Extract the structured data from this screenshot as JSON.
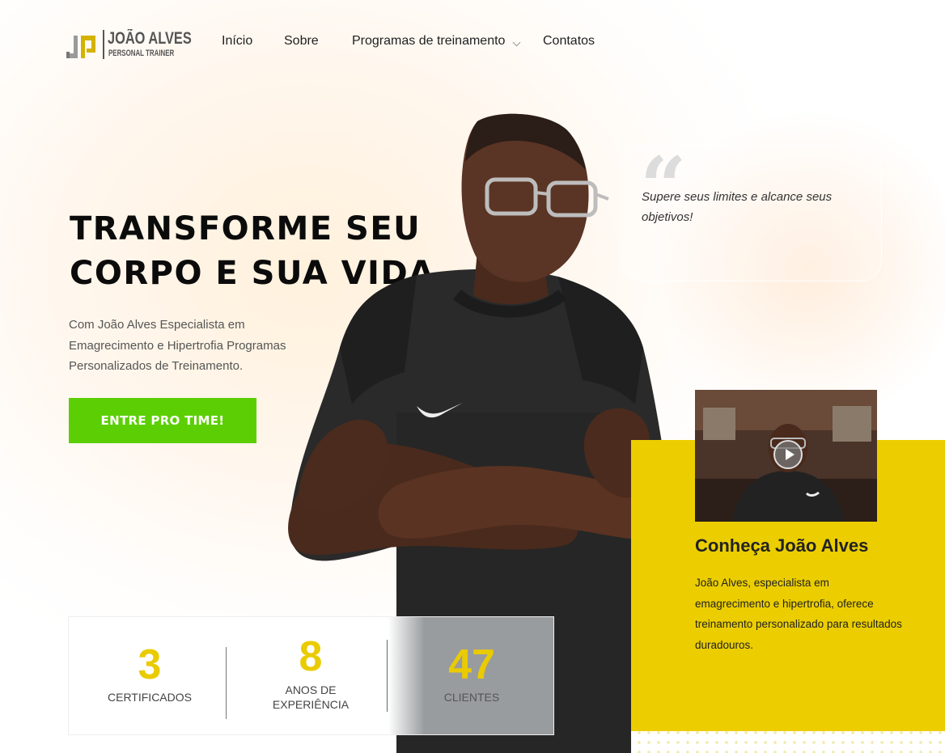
{
  "brand": {
    "name": "JOÃO ALVES",
    "subtitle": "PERSONAL TRAINER",
    "icon": "jp-monogram-logo"
  },
  "nav": {
    "items": [
      {
        "label": "Início"
      },
      {
        "label": "Sobre"
      },
      {
        "label": "Programas de treinamento",
        "has_dropdown": true
      },
      {
        "label": "Contatos"
      }
    ]
  },
  "hero": {
    "title_line1": "TRANSFORME SEU",
    "title_line2": "CORPO E SUA VIDA",
    "description": "Com João Alves Especialista em Emagrecimento e Hipertrofia Programas Personalizados de Treinamento.",
    "cta_label": "ENTRE PRO TIME!"
  },
  "quote": {
    "text": "Supere seus limites e alcance seus objetivos!",
    "icon": "quote-icon"
  },
  "about": {
    "title": "Conheça João Alves",
    "description": "João Alves, especialista em emagrecimento e hipertrofia, oferece treinamento personalizado para resultados duradouros.",
    "video_icon": "play-icon"
  },
  "stats": [
    {
      "value": "3",
      "label": "CERTIFICADOS"
    },
    {
      "value": "8",
      "label": "ANOS DE EXPERIÊNCIA"
    },
    {
      "value": "47",
      "label": "CLIENTES"
    }
  ],
  "colors": {
    "accent_yellow": "#ECCE00",
    "cta_green": "#5CCF04",
    "text_dark": "#0B0B0B"
  }
}
